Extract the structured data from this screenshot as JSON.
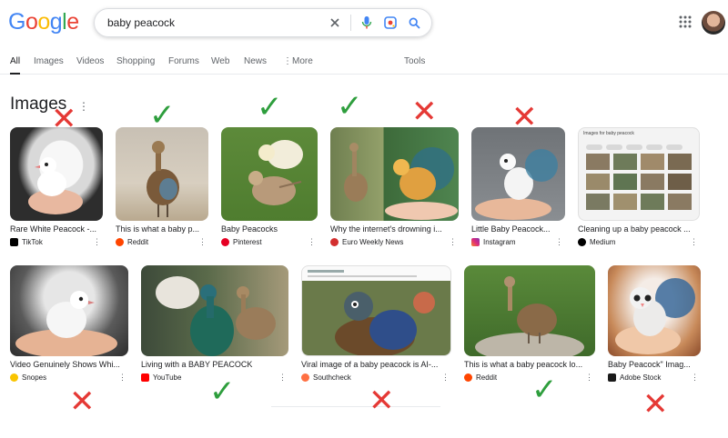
{
  "logo": {
    "letters": [
      "G",
      "o",
      "o",
      "g",
      "l",
      "e"
    ],
    "colors": [
      "#4285F4",
      "#EA4335",
      "#FBBC05",
      "#4285F4",
      "#34A853",
      "#EA4335"
    ]
  },
  "search": {
    "query": "baby peacock"
  },
  "tabs": [
    {
      "label": "All",
      "active": true
    },
    {
      "label": "Images"
    },
    {
      "label": "Videos"
    },
    {
      "label": "Shopping"
    },
    {
      "label": "Forums"
    },
    {
      "label": "Web"
    },
    {
      "label": "News"
    },
    {
      "label": "More"
    },
    {
      "label": "Tools"
    }
  ],
  "images_heading": "Images",
  "results": [
    {
      "title": "Rare White Peacock -...",
      "source": "TikTok",
      "icon": "tiktok-icon",
      "icon_color": "#000000",
      "verdict": "x"
    },
    {
      "title": "This is what a baby p...",
      "source": "Reddit",
      "icon": "reddit-icon",
      "icon_color": "#ff4500",
      "verdict": "check"
    },
    {
      "title": "Baby Peacocks",
      "source": "Pinterest",
      "icon": "pinterest-icon",
      "icon_color": "#e60023",
      "verdict": "check"
    },
    {
      "title": "Why the internet's drowning i...",
      "source": "Euro Weekly News",
      "icon": "ewn-icon",
      "icon_color": "#d32f2f",
      "verdict": "check"
    },
    {
      "title": "Little Baby Peacock...",
      "source": "Instagram",
      "icon": "instagram-icon",
      "icon_color": "#c13584",
      "verdict": "x"
    },
    {
      "title": "Cleaning up a baby peacock ...",
      "source": "Medium",
      "icon": "medium-icon",
      "icon_color": "#000000",
      "verdict": "x"
    },
    {
      "title": "Video Genuinely Shows Whi...",
      "source": "Snopes",
      "icon": "snopes-icon",
      "icon_color": "#f9c400",
      "verdict": "x"
    },
    {
      "title": "Living with a BABY PEACOCK",
      "source": "YouTube",
      "icon": "youtube-icon",
      "icon_color": "#ff0000",
      "verdict": "check"
    },
    {
      "title": "Viral image of a baby peacock is AI-...",
      "source": "Southcheck",
      "icon": "southcheck-icon",
      "icon_color": "#ff7043",
      "verdict": "x"
    },
    {
      "title": "This is what a baby peacock lo...",
      "source": "Reddit",
      "icon": "reddit-icon",
      "icon_color": "#ff4500",
      "verdict": "check"
    },
    {
      "title": "Baby Peacock\" Imag...",
      "source": "Adobe Stock",
      "icon": "adobe-stock-icon",
      "icon_color": "#1a1a1a",
      "verdict": "x"
    }
  ],
  "thumb_caption": "Images for baby peacock"
}
